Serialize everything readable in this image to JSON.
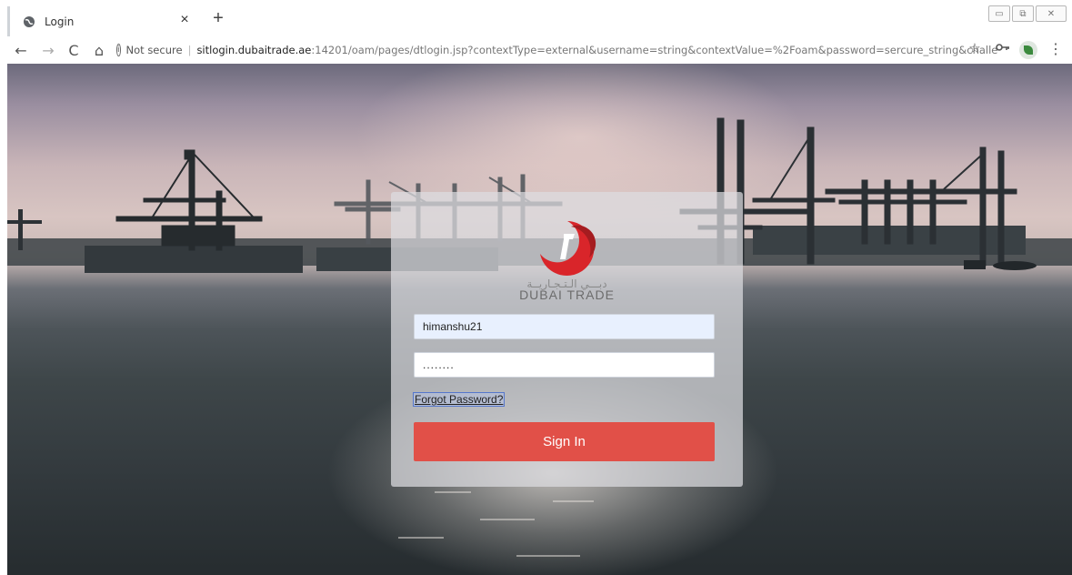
{
  "browser": {
    "tab_title": "Login",
    "tab_close": "×",
    "new_tab": "+",
    "window_controls": {
      "minimize": "▭",
      "maximize": "⧉",
      "close": "✕"
    },
    "nav": {
      "back": "←",
      "forward": "→",
      "reload": "C",
      "home": "⌂"
    },
    "address": {
      "info_icon": "ⓘ",
      "security_label": "Not secure",
      "separator": "|",
      "url_host": "sitlogin.dubaitrade.ae",
      "url_rest": ":14201/oam/pages/dtlogin.jsp?contextType=external&username=string&contextValue=%2Foam&password=sercure_string&challeng..."
    },
    "icons": {
      "bookmark": "star-icon",
      "passwords": "key-icon",
      "extension": "extension-icon",
      "menu": "kebab-menu-icon"
    },
    "bookmark_glyph": "☆",
    "key_glyph": "⚷",
    "menu_glyph": "⋮"
  },
  "login": {
    "logo_arabic": "دبـــي الـتـجـاريــة",
    "logo_name": "DUBAI TRADE",
    "brand_color": "#d9252a",
    "username_value": "himanshu21",
    "password_value": "........",
    "forgot_label": "Forgot Password?",
    "signin_label": "Sign In",
    "signin_color": "#e15048"
  }
}
